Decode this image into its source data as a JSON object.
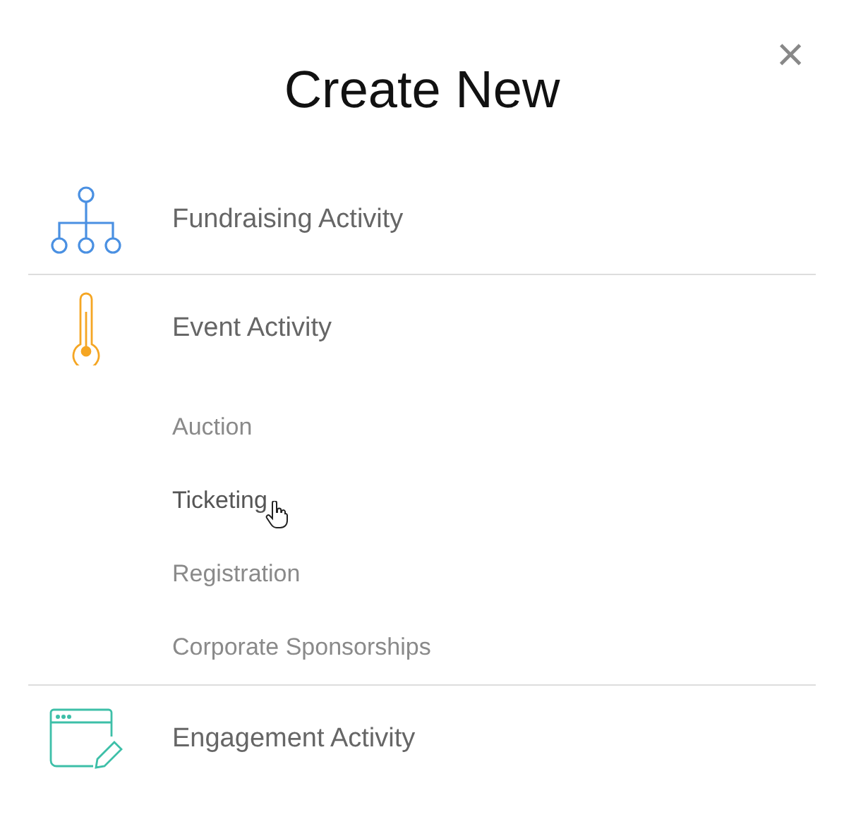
{
  "dialog": {
    "title": "Create New",
    "close": "×"
  },
  "sections": [
    {
      "label": "Fundraising Activity",
      "color": "#4a90e2"
    },
    {
      "label": "Event Activity",
      "color": "#f5a623",
      "children": [
        {
          "label": "Auction",
          "hovered": false
        },
        {
          "label": "Ticketing",
          "hovered": true
        },
        {
          "label": "Registration",
          "hovered": false
        },
        {
          "label": "Corporate Sponsorships",
          "hovered": false
        }
      ]
    },
    {
      "label": "Engagement Activity",
      "color": "#3dbfa8"
    }
  ]
}
